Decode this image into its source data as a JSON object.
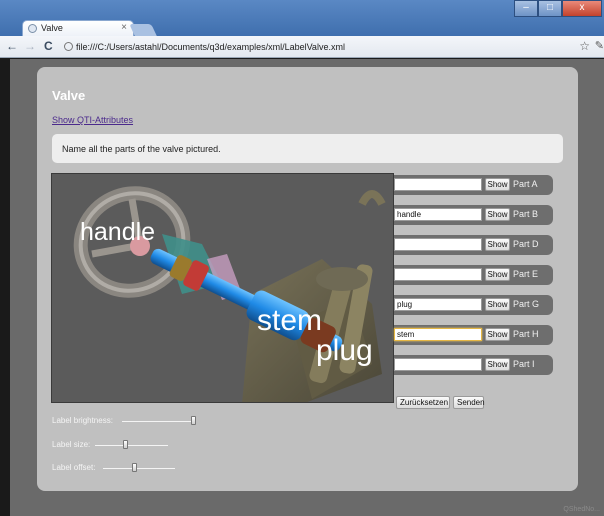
{
  "browser": {
    "tab_title": "Valve",
    "tab_close": "×",
    "back": "←",
    "forward": "→",
    "reload": "C",
    "address": "file:///C:/Users/astahl/Documents/q3d/examples/xml/LabelValve.xml",
    "win_min": "–",
    "win_max": "□",
    "win_close": "x",
    "star": "☆",
    "wrench": "✎"
  },
  "page": {
    "title": "Valve",
    "qti_link": "Show QTI-Attributes",
    "prompt": "Name all the parts of the valve pictured."
  },
  "viewport": {
    "labels": [
      "handle",
      "stem",
      "plug"
    ]
  },
  "parts": [
    {
      "label": "Part A",
      "value": "",
      "button": "Show",
      "focused": false
    },
    {
      "label": "Part B",
      "value": "handle",
      "button": "Show",
      "focused": false
    },
    {
      "label": "Part D",
      "value": "",
      "button": "Show",
      "focused": false
    },
    {
      "label": "Part E",
      "value": "",
      "button": "Show",
      "focused": false
    },
    {
      "label": "Part G",
      "value": "plug",
      "button": "Show",
      "focused": false
    },
    {
      "label": "Part H",
      "value": "stem",
      "button": "Show",
      "focused": true
    },
    {
      "label": "Part I",
      "value": "",
      "button": "Show",
      "focused": false
    }
  ],
  "actions": {
    "reset": "Zurücksetzen",
    "submit": "Senden"
  },
  "sliders": [
    {
      "label": "Label brightness:",
      "value": 1.0
    },
    {
      "label": "Label size:",
      "value": 0.42
    },
    {
      "label": "Label offset:",
      "value": 0.45
    }
  ],
  "watermark": "QShedNo..."
}
